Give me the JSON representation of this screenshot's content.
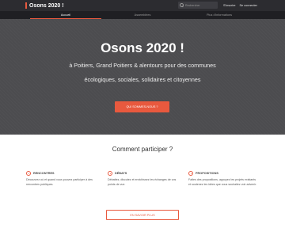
{
  "header": {
    "logo": "Osons 2020 !",
    "search_placeholder": "Rechercher",
    "signup": "S'inscrire",
    "login": "Se connecter"
  },
  "nav": {
    "tabs": [
      {
        "label": "Accueil"
      },
      {
        "label": "Assemblées"
      },
      {
        "label": "Plus d'informations"
      }
    ]
  },
  "hero": {
    "title": "Osons 2020 !",
    "line1": "à Poitiers, Grand Poitiers & alentours pour des communes",
    "line2": "écologiques, sociales, solidaires et citoyennes",
    "button": "QUI SOMMES-NOUS ?"
  },
  "participation": {
    "title": "Comment participer ?",
    "cards": [
      {
        "label": "RENCONTRES",
        "text": "Découvrez où et quand vous pouvez participer à des rencontres publiques."
      },
      {
        "label": "DÉBATS",
        "text": "Débattez, discutez et enrichissez les échanges de vos points de vue."
      },
      {
        "label": "PROPOSITIONS",
        "text": "Faites des propositions, appuyez les projets existants et soutenez les idées que vous souhaitez voir advenir."
      }
    ],
    "more_button": "EN SAVOIR PLUS"
  },
  "colors": {
    "accent": "#e8593e",
    "topbar": "#2c2c30",
    "navbar": "#1f1f23",
    "hero_bg": "#4c4c4f"
  }
}
